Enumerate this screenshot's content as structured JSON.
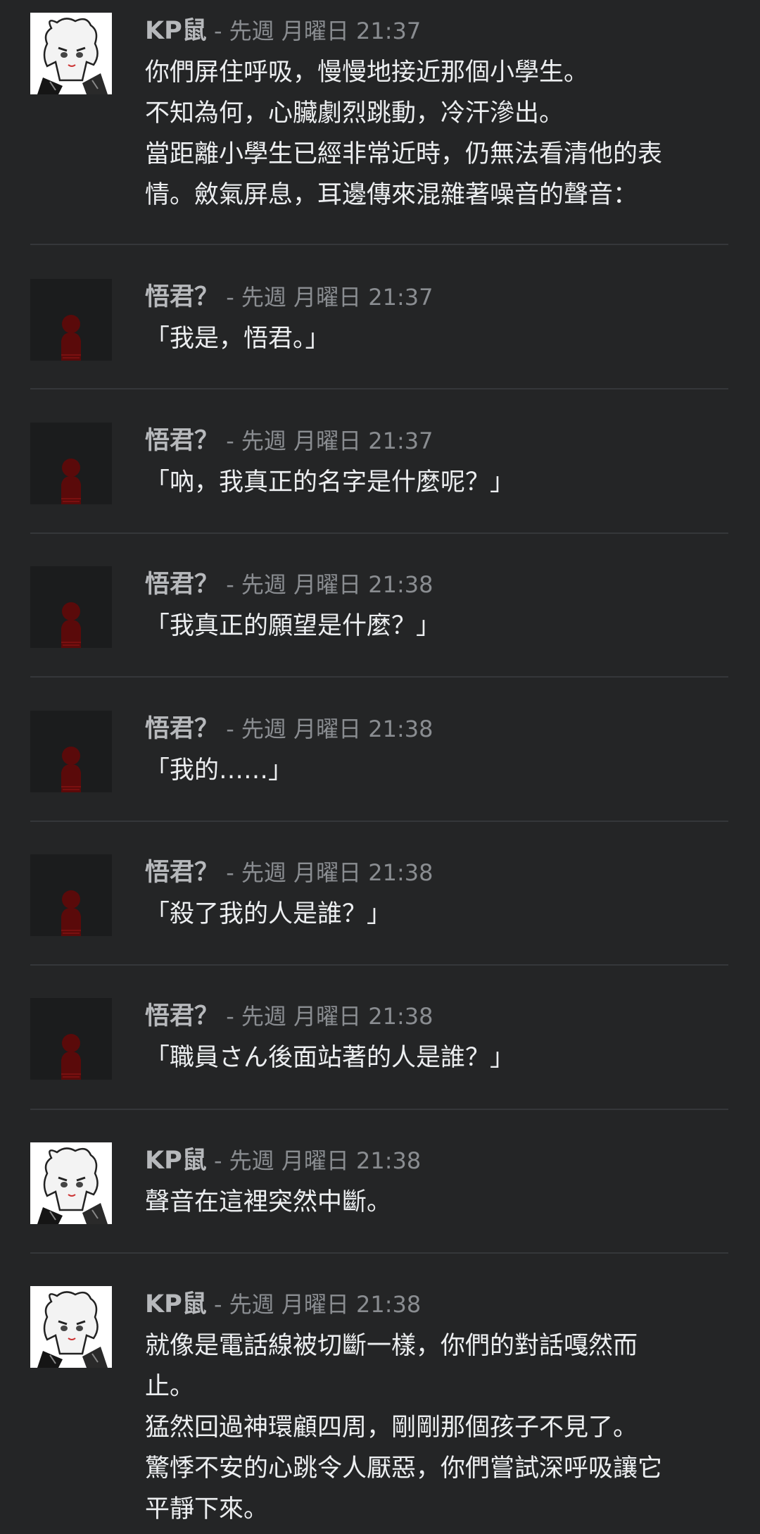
{
  "messages": [
    {
      "author": "KP鼠",
      "time": "先週 月曜日 21:37",
      "avatar": "kp",
      "text": "你們屏住呼吸，慢慢地接近那個小學生。\n不知為何，心臟劇烈跳動，冷汗滲出。\n當距離小學生已經非常近時，仍無法看清他的表\n情。斂氣屏息，耳邊傳來混雜著噪音的聲音："
    },
    {
      "author": "悟君？",
      "time": "先週 月曜日 21:37",
      "avatar": "wu",
      "text": "「我是，悟君。」"
    },
    {
      "author": "悟君？",
      "time": "先週 月曜日 21:37",
      "avatar": "wu",
      "text": "「吶，我真正的名字是什麼呢？」"
    },
    {
      "author": "悟君？",
      "time": "先週 月曜日 21:38",
      "avatar": "wu",
      "text": "「我真正的願望是什麼？」"
    },
    {
      "author": "悟君？",
      "time": "先週 月曜日 21:38",
      "avatar": "wu",
      "text": "「我的……」"
    },
    {
      "author": "悟君？",
      "time": "先週 月曜日 21:38",
      "avatar": "wu",
      "text": "「殺了我的人是誰？」"
    },
    {
      "author": "悟君？",
      "time": "先週 月曜日 21:38",
      "avatar": "wu",
      "text": "「職員さん後面站著的人是誰？」"
    },
    {
      "author": "KP鼠",
      "time": "先週 月曜日 21:38",
      "avatar": "kp",
      "text": "聲音在這裡突然中斷。"
    },
    {
      "author": "KP鼠",
      "time": "先週 月曜日 21:38",
      "avatar": "kp",
      "text": "就像是電話線被切斷一樣，你們的對話嘎然而\n止。\n猛然回過神環顧四周，剛剛那個孩子不見了。\n驚悸不安的心跳令人厭惡，你們嘗試深呼吸讓它\n平靜下來。"
    }
  ],
  "separator": " - "
}
